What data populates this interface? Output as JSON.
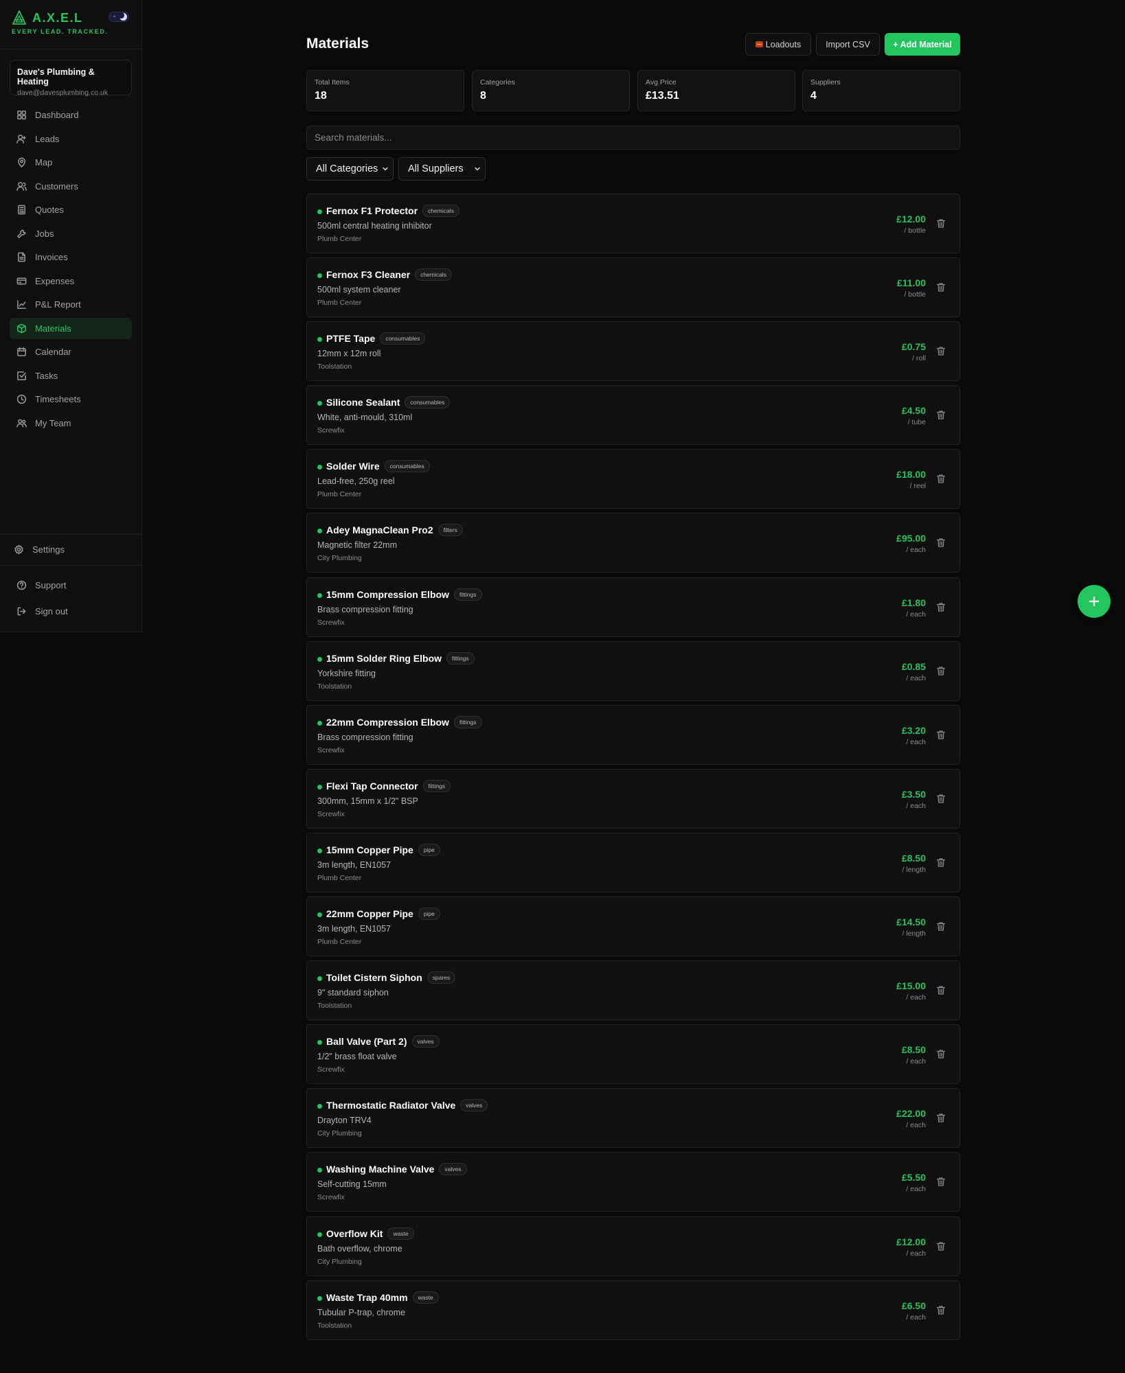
{
  "brand": {
    "name": "A.X.E.L",
    "tagline": "EVERY LEAD. TRACKED.",
    "accent_color": "#22c55e"
  },
  "account": {
    "business_name": "Dave's Plumbing & Heating",
    "email": "dave@davesplumbing.co.uk"
  },
  "sidebar": {
    "items": [
      {
        "label": "Dashboard",
        "icon": "grid-icon"
      },
      {
        "label": "Leads",
        "icon": "user-plus-icon"
      },
      {
        "label": "Map",
        "icon": "map-pin-icon"
      },
      {
        "label": "Customers",
        "icon": "users-icon"
      },
      {
        "label": "Quotes",
        "icon": "calculator-icon"
      },
      {
        "label": "Jobs",
        "icon": "wrench-icon"
      },
      {
        "label": "Invoices",
        "icon": "file-icon"
      },
      {
        "label": "Expenses",
        "icon": "credit-card-icon"
      },
      {
        "label": "P&L Report",
        "icon": "chart-line-icon"
      },
      {
        "label": "Materials",
        "icon": "box-icon",
        "active": true
      },
      {
        "label": "Calendar",
        "icon": "calendar-icon"
      },
      {
        "label": "Tasks",
        "icon": "check-square-icon"
      },
      {
        "label": "Timesheets",
        "icon": "clock-icon"
      },
      {
        "label": "My Team",
        "icon": "team-icon"
      }
    ],
    "settings_label": "Settings",
    "support_label": "Support",
    "signout_label": "Sign out"
  },
  "header": {
    "title": "Materials",
    "loadouts_label": "Loadouts",
    "import_label": "Import CSV",
    "add_label": "+ Add Material"
  },
  "stats": [
    {
      "label": "Total Items",
      "value": "18"
    },
    {
      "label": "Categories",
      "value": "8"
    },
    {
      "label": "Avg Price",
      "value": "£13.51"
    },
    {
      "label": "Suppliers",
      "value": "4"
    }
  ],
  "search": {
    "placeholder": "Search materials...",
    "value": ""
  },
  "filters": {
    "category": "All Categories",
    "supplier": "All Suppliers"
  },
  "materials": [
    {
      "name": "Fernox F1 Protector",
      "category": "chemicals",
      "description": "500ml central heating inhibitor",
      "supplier": "Plumb Center",
      "price": "£12.00",
      "unit": "/ bottle"
    },
    {
      "name": "Fernox F3 Cleaner",
      "category": "chemicals",
      "description": "500ml system cleaner",
      "supplier": "Plumb Center",
      "price": "£11.00",
      "unit": "/ bottle"
    },
    {
      "name": "PTFE Tape",
      "category": "consumables",
      "description": "12mm x 12m roll",
      "supplier": "Toolstation",
      "price": "£0.75",
      "unit": "/ roll"
    },
    {
      "name": "Silicone Sealant",
      "category": "consumables",
      "description": "White, anti-mould, 310ml",
      "supplier": "Screwfix",
      "price": "£4.50",
      "unit": "/ tube"
    },
    {
      "name": "Solder Wire",
      "category": "consumables",
      "description": "Lead-free, 250g reel",
      "supplier": "Plumb Center",
      "price": "£18.00",
      "unit": "/ reel"
    },
    {
      "name": "Adey MagnaClean Pro2",
      "category": "filters",
      "description": "Magnetic filter 22mm",
      "supplier": "City Plumbing",
      "price": "£95.00",
      "unit": "/ each"
    },
    {
      "name": "15mm Compression Elbow",
      "category": "fittings",
      "description": "Brass compression fitting",
      "supplier": "Screwfix",
      "price": "£1.80",
      "unit": "/ each"
    },
    {
      "name": "15mm Solder Ring Elbow",
      "category": "fittings",
      "description": "Yorkshire fitting",
      "supplier": "Toolstation",
      "price": "£0.85",
      "unit": "/ each"
    },
    {
      "name": "22mm Compression Elbow",
      "category": "fittings",
      "description": "Brass compression fitting",
      "supplier": "Screwfix",
      "price": "£3.20",
      "unit": "/ each"
    },
    {
      "name": "Flexi Tap Connector",
      "category": "fittings",
      "description": "300mm, 15mm x 1/2\" BSP",
      "supplier": "Screwfix",
      "price": "£3.50",
      "unit": "/ each"
    },
    {
      "name": "15mm Copper Pipe",
      "category": "pipe",
      "description": "3m length, EN1057",
      "supplier": "Plumb Center",
      "price": "£8.50",
      "unit": "/ length"
    },
    {
      "name": "22mm Copper Pipe",
      "category": "pipe",
      "description": "3m length, EN1057",
      "supplier": "Plumb Center",
      "price": "£14.50",
      "unit": "/ length"
    },
    {
      "name": "Toilet Cistern Siphon",
      "category": "spares",
      "description": "9\" standard siphon",
      "supplier": "Toolstation",
      "price": "£15.00",
      "unit": "/ each"
    },
    {
      "name": "Ball Valve (Part 2)",
      "category": "valves",
      "description": "1/2\" brass float valve",
      "supplier": "Screwfix",
      "price": "£8.50",
      "unit": "/ each"
    },
    {
      "name": "Thermostatic Radiator Valve",
      "category": "valves",
      "description": "Drayton TRV4",
      "supplier": "City Plumbing",
      "price": "£22.00",
      "unit": "/ each"
    },
    {
      "name": "Washing Machine Valve",
      "category": "valves",
      "description": "Self-cutting 15mm",
      "supplier": "Screwfix",
      "price": "£5.50",
      "unit": "/ each"
    },
    {
      "name": "Overflow Kit",
      "category": "waste",
      "description": "Bath overflow, chrome",
      "supplier": "City Plumbing",
      "price": "£12.00",
      "unit": "/ each"
    },
    {
      "name": "Waste Trap 40mm",
      "category": "waste",
      "description": "Tubular P-trap, chrome",
      "supplier": "Toolstation",
      "price": "£6.50",
      "unit": "/ each"
    }
  ]
}
